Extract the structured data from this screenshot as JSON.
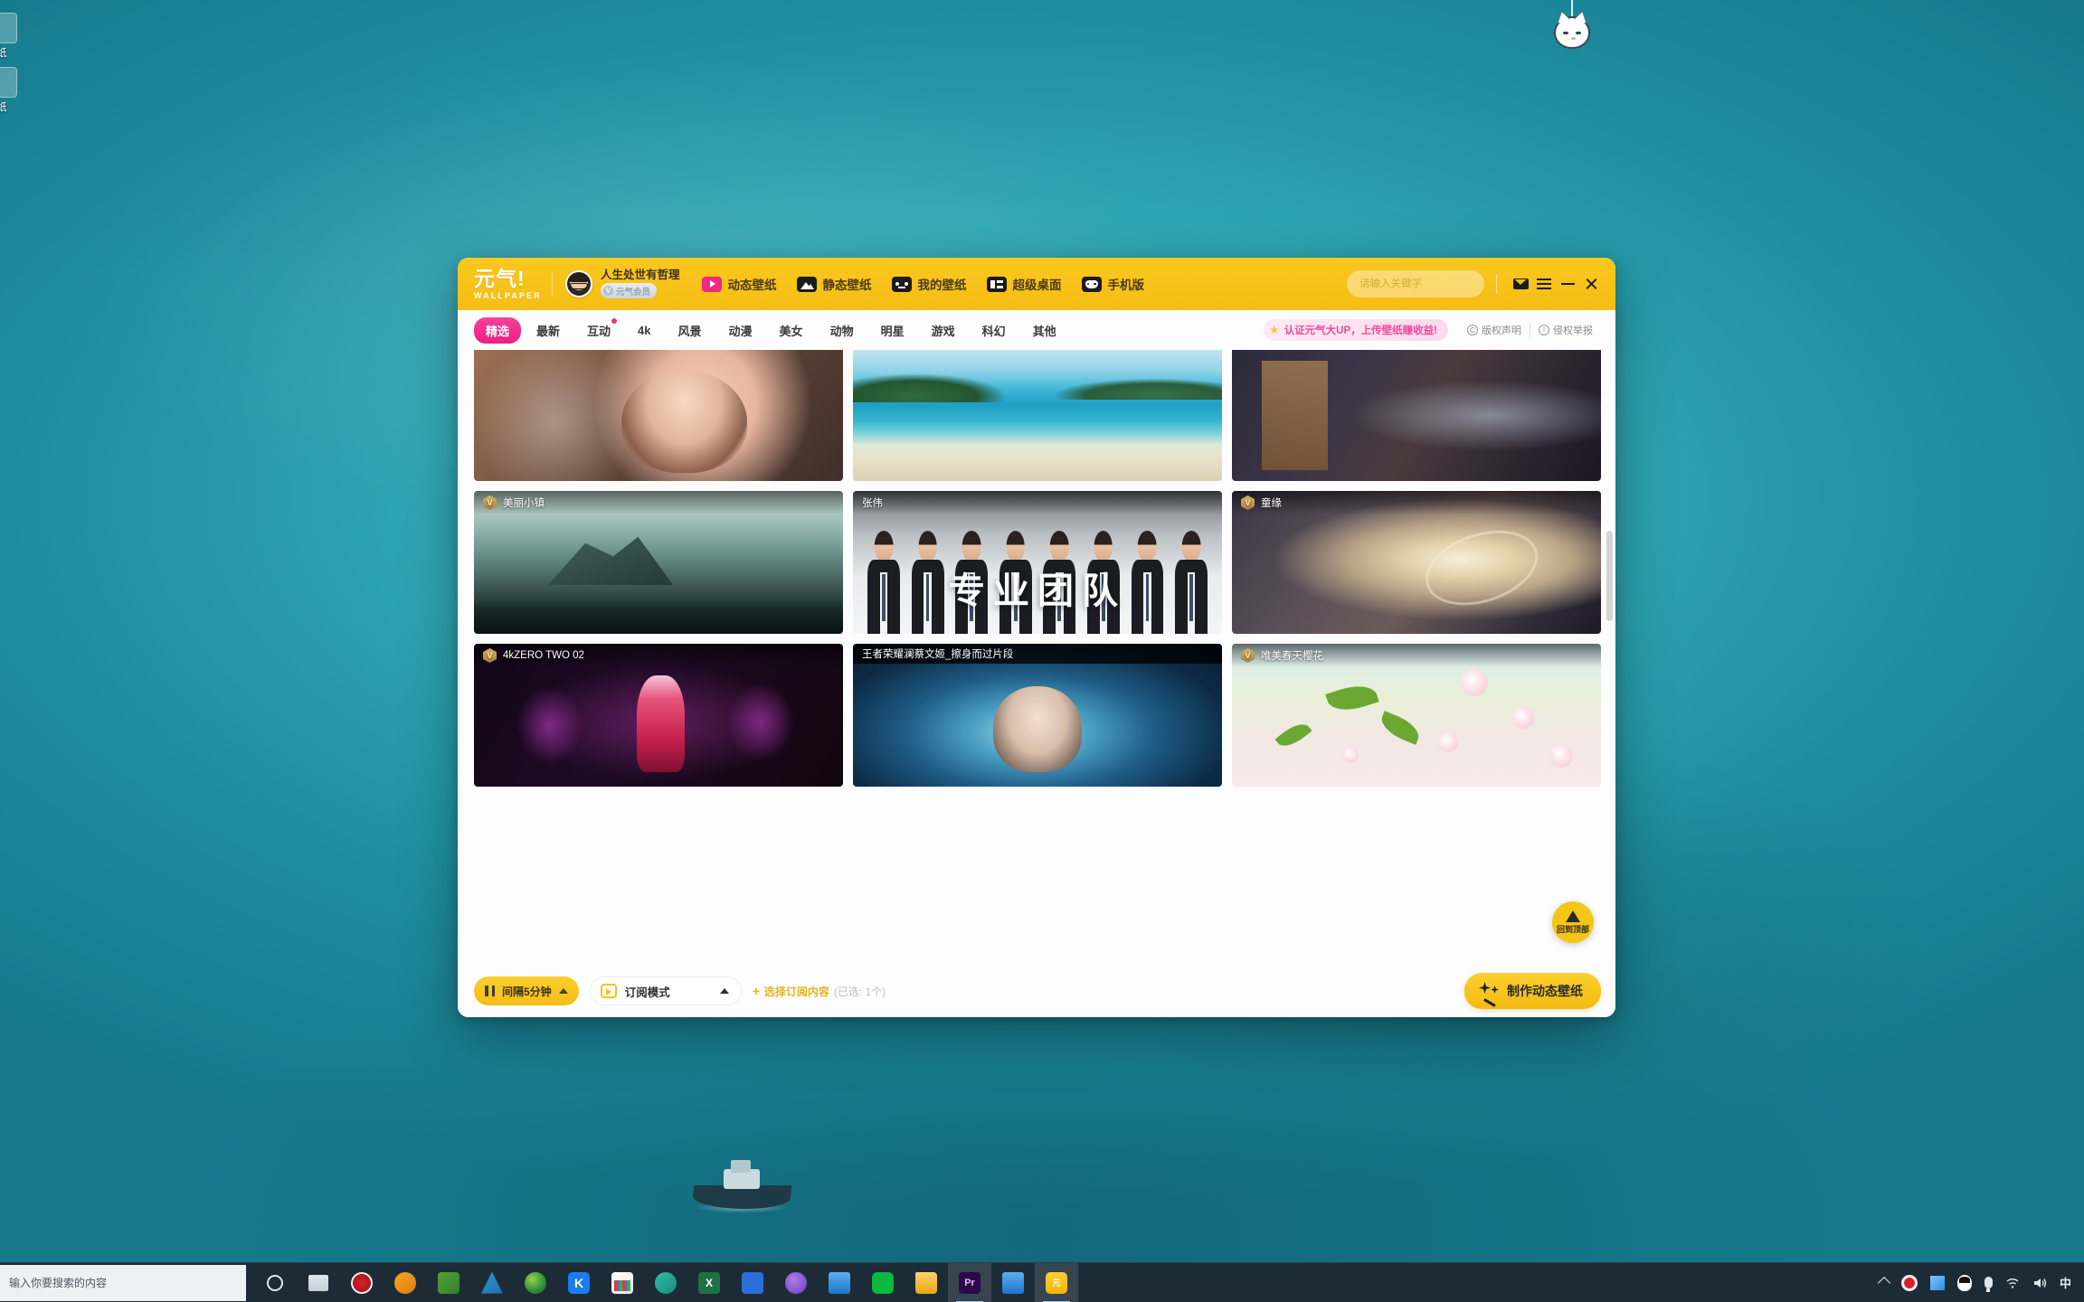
{
  "desktop": {
    "icons": [
      {
        "label": "纸"
      },
      {
        "label": "纸"
      }
    ],
    "cat_widget_name": "cat-ornament"
  },
  "app": {
    "brand": {
      "cn": "元气!",
      "en": "WALLPAPER"
    },
    "user": {
      "name": "人生处世有哲理",
      "vip_badge": "元气会员",
      "vip_mark": "V"
    },
    "nav": [
      {
        "label": "动态壁纸",
        "icon": "dynamic-wallpaper-icon"
      },
      {
        "label": "静态壁纸",
        "icon": "static-wallpaper-icon"
      },
      {
        "label": "我的壁纸",
        "icon": "my-wallpaper-icon"
      },
      {
        "label": "超级桌面",
        "icon": "super-desktop-icon"
      },
      {
        "label": "手机版",
        "icon": "mobile-version-icon"
      }
    ],
    "search": {
      "placeholder": "请输入关键字",
      "value": ""
    },
    "window_controls": {
      "mail": "mail-icon",
      "menu": "hamburger-menu-icon",
      "minimize": "minimize-icon",
      "close": "close-icon"
    },
    "categories": [
      {
        "label": "精选",
        "active": true,
        "badge": false
      },
      {
        "label": "最新",
        "active": false,
        "badge": false
      },
      {
        "label": "互动",
        "active": false,
        "badge": true
      },
      {
        "label": "4k",
        "active": false,
        "badge": false
      },
      {
        "label": "风景",
        "active": false,
        "badge": false
      },
      {
        "label": "动漫",
        "active": false,
        "badge": false
      },
      {
        "label": "美女",
        "active": false,
        "badge": false
      },
      {
        "label": "动物",
        "active": false,
        "badge": false
      },
      {
        "label": "明星",
        "active": false,
        "badge": false
      },
      {
        "label": "游戏",
        "active": false,
        "badge": false
      },
      {
        "label": "科幻",
        "active": false,
        "badge": false
      },
      {
        "label": "其他",
        "active": false,
        "badge": false
      }
    ],
    "promo": {
      "text": "认证元气大UP，上传壁纸赚收益!",
      "star": "★"
    },
    "legal": [
      {
        "label": "版权声明",
        "mark": "C"
      },
      {
        "label": "侵权举报",
        "mark": "!"
      }
    ],
    "grid": [
      {
        "title": "",
        "vip": false,
        "art": "art-anime",
        "first_row": true
      },
      {
        "title": "",
        "vip": false,
        "art": "art-beach",
        "first_row": true
      },
      {
        "title": "",
        "vip": false,
        "art": "art-hanfu",
        "first_row": true
      },
      {
        "title": "美丽小镇",
        "vip": true,
        "art": "art-town",
        "first_row": false
      },
      {
        "title": "张伟",
        "vip": false,
        "art": "art-team",
        "first_row": false,
        "caption": "专业团队"
      },
      {
        "title": "童缘",
        "vip": true,
        "art": "art-tongyuan",
        "first_row": false
      },
      {
        "title": "4kZERO TWO 02",
        "vip": true,
        "art": "art-zero",
        "first_row": false
      },
      {
        "title": "王者荣耀澜蔡文姬_擦身而过片段",
        "vip": false,
        "art": "art-honor",
        "first_row": false,
        "dark_band": true
      },
      {
        "title": "唯美春天樱花",
        "vip": true,
        "art": "art-sakura",
        "first_row": false
      }
    ],
    "back_to_top": {
      "label": "回到顶部"
    },
    "bottom": {
      "interval": {
        "label": "间隔5分钟",
        "icon": "pause-icon"
      },
      "mode": {
        "label": "订阅模式",
        "icon": "tv-icon"
      },
      "subscribe": {
        "plus": "+",
        "label": "选择订阅内容",
        "count": "(已选: 1个)"
      },
      "make": {
        "label": "制作动态壁纸",
        "icon": "magic-wand-icon"
      }
    }
  },
  "taskbar": {
    "search_placeholder": "输入你要搜索的内容",
    "apps": [
      {
        "name": "cortana",
        "cls": "ic-cortana",
        "text": ""
      },
      {
        "name": "task-view",
        "cls": "ic-taskview",
        "text": ""
      },
      {
        "name": "screen-recorder",
        "cls": "ic-rec",
        "text": ""
      },
      {
        "name": "orange-app",
        "cls": "ic-orange",
        "text": ""
      },
      {
        "name": "green-app",
        "cls": "ic-green",
        "text": ""
      },
      {
        "name": "autocad",
        "cls": "ic-a",
        "text": ""
      },
      {
        "name": "browser",
        "cls": "ic-globe",
        "text": ""
      },
      {
        "name": "kugou",
        "cls": "ic-k",
        "text": "K"
      },
      {
        "name": "chart-app",
        "cls": "ic-chart",
        "text": ""
      },
      {
        "name": "teal-app",
        "cls": "ic-teal",
        "text": ""
      },
      {
        "name": "excel",
        "cls": "ic-excel",
        "text": "X"
      },
      {
        "name": "blue-app",
        "cls": "ic-blueapp",
        "text": ""
      },
      {
        "name": "purple-app",
        "cls": "ic-purple",
        "text": ""
      },
      {
        "name": "office-app",
        "cls": "ic-blue2",
        "text": ""
      },
      {
        "name": "wechat",
        "cls": "ic-wechat",
        "text": ""
      },
      {
        "name": "file-explorer",
        "cls": "ic-folder",
        "text": ""
      },
      {
        "name": "premiere",
        "cls": "ic-pr",
        "text": "Pr"
      },
      {
        "name": "store",
        "cls": "ic-blue2",
        "text": ""
      },
      {
        "name": "yuanqi-wallpaper",
        "cls": "ic-yuanqi",
        "text": "元"
      }
    ],
    "tray": {
      "ime": "中",
      "volume": "◀))",
      "wifi": "((",
      "items": [
        "show-hidden-icons",
        "recorder",
        "blue-app",
        "qq",
        "microphone",
        "wifi",
        "volume",
        "ime"
      ]
    }
  }
}
